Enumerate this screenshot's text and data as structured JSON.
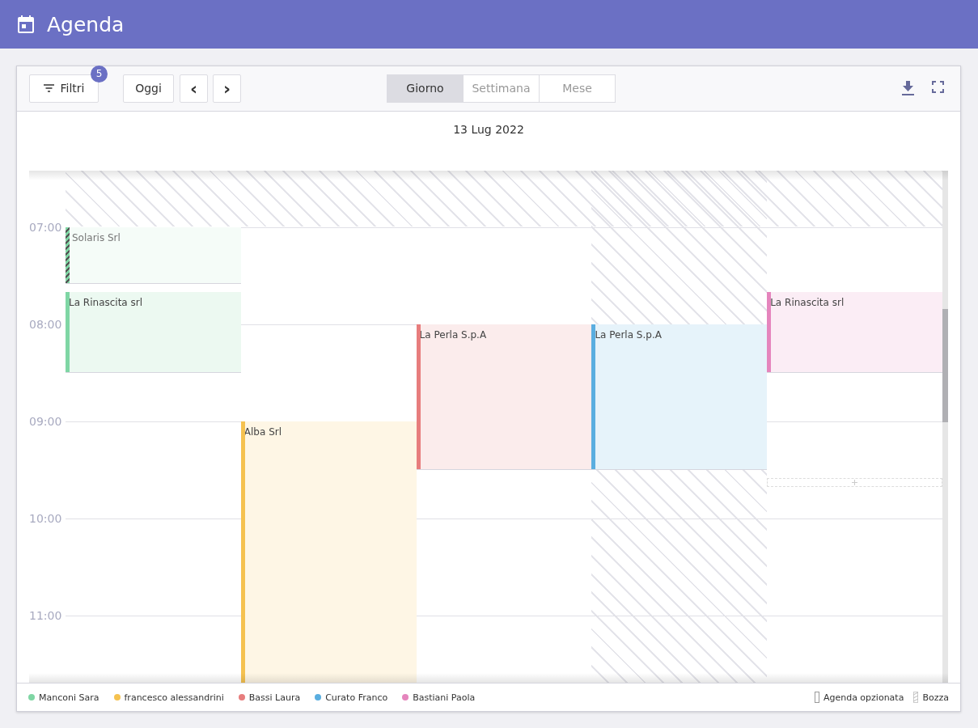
{
  "header": {
    "title": "Agenda"
  },
  "toolbar": {
    "filter": {
      "label": "Filtri",
      "badge": "5"
    },
    "today": "Oggi",
    "prev": "‹",
    "next": "›",
    "views": [
      {
        "label": "Giorno",
        "selected": true
      },
      {
        "label": "Settimana",
        "selected": false
      },
      {
        "label": "Mese",
        "selected": false
      }
    ]
  },
  "date": "13 Lug 2022",
  "hours": [
    "07:00",
    "08:00",
    "09:00",
    "10:00",
    "11:00"
  ],
  "columns": [
    {
      "unavailable": false,
      "events": [
        {
          "title": "Solaris Srl",
          "color": "#7fd6a4",
          "draft": true
        },
        {
          "title": "La Rinascita srl",
          "color": "#7fd6a4",
          "draft": false
        }
      ]
    },
    {
      "unavailable": false,
      "events": [
        {
          "title": "Alba Srl",
          "color": "#f5c250",
          "draft": false
        }
      ]
    },
    {
      "unavailable": false,
      "events": [
        {
          "title": "La Perla S.p.A",
          "color": "#e77d7d",
          "draft": false
        }
      ]
    },
    {
      "unavailable": true,
      "events": [
        {
          "title": "La Perla S.p.A",
          "color": "#5aaee0",
          "draft": false
        }
      ]
    },
    {
      "unavailable": false,
      "events": [
        {
          "title": "La Rinascita srl",
          "color": "#e585bd",
          "draft": false
        }
      ]
    }
  ],
  "legend": [
    {
      "name": "Manconi Sara",
      "color": "#7fd6a4"
    },
    {
      "name": "francesco alessandrini",
      "color": "#f5c250"
    },
    {
      "name": "Bassi Laura",
      "color": "#e77d7d"
    },
    {
      "name": "Curato Franco",
      "color": "#5aaee0"
    },
    {
      "name": "Bastiani Paola",
      "color": "#e585bd"
    }
  ],
  "key": [
    {
      "kind": "optioned",
      "label": "Agenda opzionata"
    },
    {
      "kind": "draft",
      "label": "Bozza"
    }
  ]
}
